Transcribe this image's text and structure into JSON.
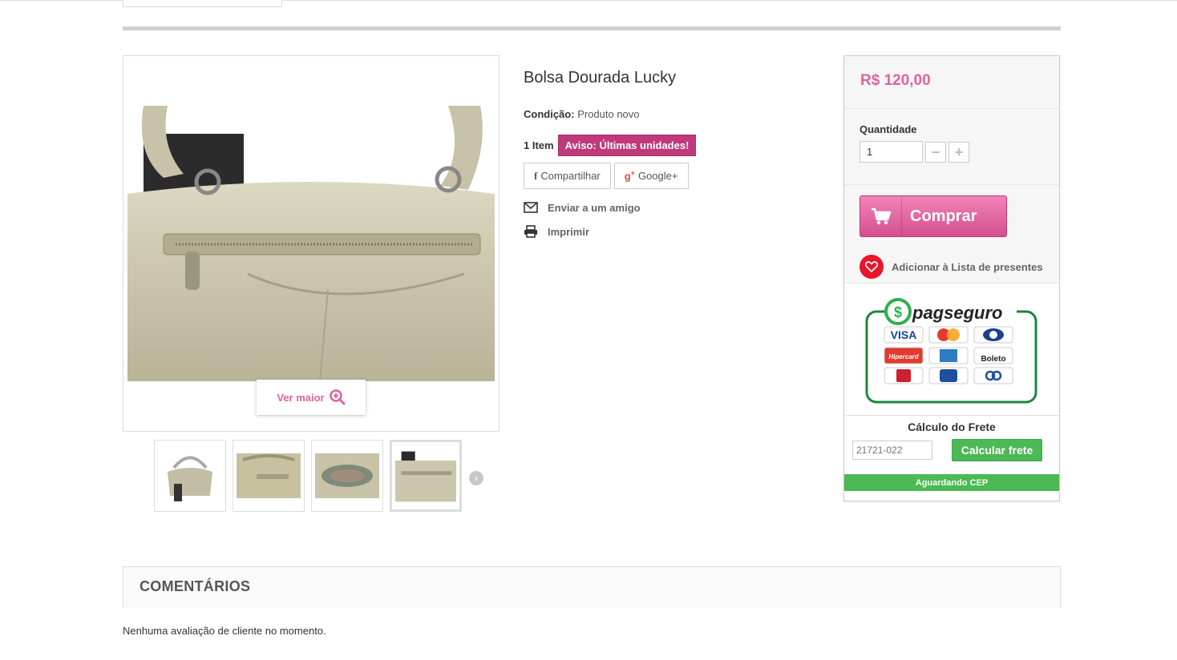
{
  "product": {
    "title": "Bolsa Dourada Lucky",
    "condition_label": "Condição:",
    "condition_value": "Produto novo",
    "stock_qty": "1 Item",
    "stock_warning": "Aviso: Últimas unidades!",
    "zoom_label": "Ver maior"
  },
  "share": {
    "facebook_label": "Compartilhar",
    "google_label": "Google+"
  },
  "links": {
    "send_friend": "Enviar a um amigo",
    "print": "Imprimir"
  },
  "buy_box": {
    "price": "R$ 120,00",
    "quantity_label": "Quantidade",
    "quantity_value": "1",
    "minus": "−",
    "plus": "+",
    "buy_label": "Comprar",
    "wishlist_label": "Adicionar à Lista de presentes"
  },
  "pagseguro": {
    "brand": "pagseguro",
    "cards": [
      "VISA",
      "MasterCard",
      "Diners",
      "Hipercard",
      "AMEX",
      "Boleto",
      "Bradesco",
      "Itaú",
      "BB"
    ]
  },
  "shipping": {
    "title": "Cálculo do Frete",
    "cep_placeholder": "21721-022",
    "calc_button": "Calcular frete",
    "status": "Aguardando CEP"
  },
  "comments": {
    "title": "COMENTÁRIOS",
    "empty": "Nenhuma avaliação de cliente no momento."
  },
  "colors": {
    "accent_pink": "#e0629d",
    "warning": "#c0397b",
    "green": "#4bb954",
    "heart_red": "#e8152c"
  },
  "icons": [
    "zoom-plus-icon",
    "facebook-icon",
    "google-plus-icon",
    "envelope-icon",
    "printer-icon",
    "cart-icon",
    "heart-icon",
    "chevron-right-icon"
  ]
}
